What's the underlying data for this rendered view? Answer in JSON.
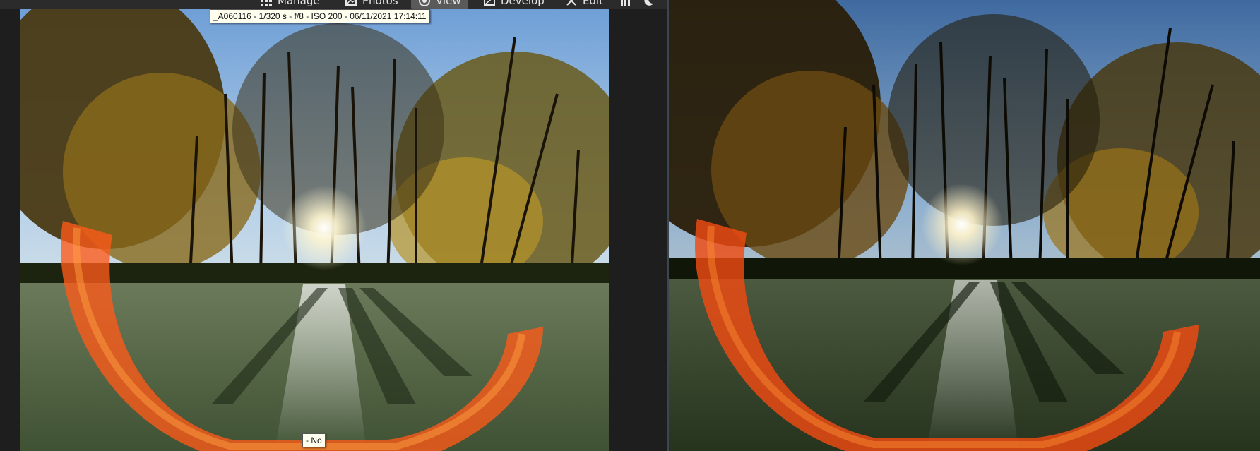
{
  "toolbar": {
    "items": [
      {
        "label": "Manage",
        "icon": "grid-icon",
        "active": false
      },
      {
        "label": "Photos",
        "icon": "photos-icon",
        "active": false
      },
      {
        "label": "View",
        "icon": "eye-icon",
        "active": true
      },
      {
        "label": "Develop",
        "icon": "develop-icon",
        "active": false
      },
      {
        "label": "Edit",
        "icon": "edit-icon",
        "active": false
      }
    ],
    "extra_icons": [
      "histogram-icon",
      "moon-icon"
    ]
  },
  "viewer": {
    "exif_tooltip": "_A060116 - 1/320 s - f/8 - ISO 200 - 06/11/2021 17:14:11",
    "rating_tooltip": "- No"
  },
  "colors": {
    "toolbar_bg": "#2b2b2b",
    "active_tab_bg": "#5a5a5a",
    "app_bg": "#1e1e1e",
    "divider": "#3c4652",
    "tooltip_bg": "#fffff0"
  }
}
